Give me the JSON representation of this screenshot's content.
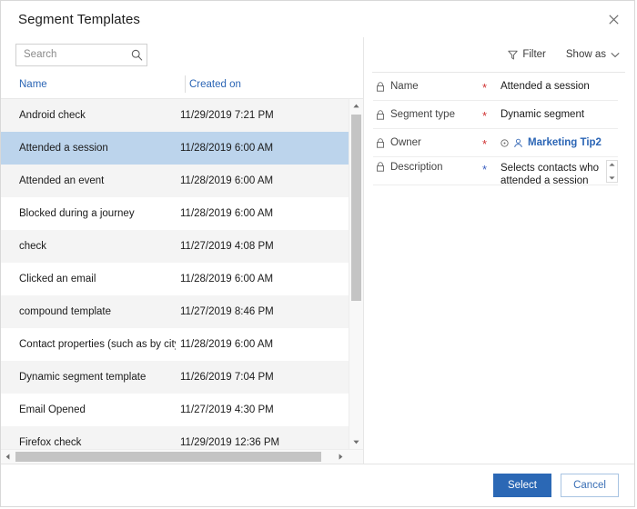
{
  "dialog": {
    "title": "Segment Templates",
    "close_label": "Close"
  },
  "search": {
    "placeholder": "Search",
    "value": "",
    "icon": "search-icon"
  },
  "toolbar": {
    "filter_label": "Filter",
    "filter_icon": "funnel-icon",
    "show_as_label": "Show as",
    "show_as_icon": "chevron-down-icon"
  },
  "list": {
    "columns": [
      {
        "label": "Name"
      },
      {
        "label": "Created on"
      }
    ],
    "rows": [
      {
        "name": "Android check",
        "created_on": "11/29/2019 7:21 PM",
        "selected": false
      },
      {
        "name": "Attended a session",
        "created_on": "11/28/2019 6:00 AM",
        "selected": true
      },
      {
        "name": "Attended an event",
        "created_on": "11/28/2019 6:00 AM",
        "selected": false
      },
      {
        "name": "Blocked during a journey",
        "created_on": "11/28/2019 6:00 AM",
        "selected": false
      },
      {
        "name": "check",
        "created_on": "11/27/2019 4:08 PM",
        "selected": false
      },
      {
        "name": "Clicked an email",
        "created_on": "11/28/2019 6:00 AM",
        "selected": false
      },
      {
        "name": "compound template",
        "created_on": "11/27/2019 8:46 PM",
        "selected": false
      },
      {
        "name": "Contact properties (such as by city)",
        "created_on": "11/28/2019 6:00 AM",
        "selected": false
      },
      {
        "name": "Dynamic segment template",
        "created_on": "11/26/2019 7:04 PM",
        "selected": false
      },
      {
        "name": "Email Opened",
        "created_on": "11/27/2019 4:30 PM",
        "selected": false
      },
      {
        "name": "Firefox check",
        "created_on": "11/29/2019 12:36 PM",
        "selected": false
      }
    ]
  },
  "details": {
    "fields": [
      {
        "label": "Name",
        "lock_icon": "lock-icon",
        "required_marker": "*",
        "required_color": "#d03232",
        "value": "Attended a session"
      },
      {
        "label": "Segment type",
        "lock_icon": "lock-icon",
        "required_marker": "*",
        "required_color": "#d03232",
        "value": "Dynamic segment"
      },
      {
        "label": "Owner",
        "lock_icon": "lock-icon",
        "required_marker": "*",
        "required_color": "#d03232",
        "value": "Marketing Tip2",
        "status_icon": "circle-icon",
        "person_icon": "person-icon"
      },
      {
        "label": "Description",
        "lock_icon": "lock-icon",
        "required_marker": "*",
        "required_color": "#3b5fc0",
        "value": "Selects contacts who attended a session",
        "spinner_icon": "updown-spinner-icon"
      }
    ]
  },
  "footer": {
    "select_label": "Select",
    "cancel_label": "Cancel"
  },
  "colors": {
    "accent_blue": "#2b68b5",
    "link_blue": "#2b65b5",
    "selected_row": "#bcd4ec",
    "alt_row": "#f4f4f4",
    "required_red": "#d03232"
  }
}
